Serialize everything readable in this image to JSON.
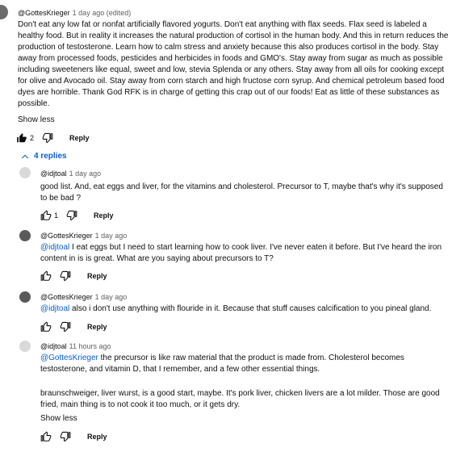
{
  "top_comment": {
    "author": "@GottesKrieger",
    "time": "1 day ago (edited)",
    "text": "Don't eat any low fat or nonfat artificially flavored yogurts. Don't eat anything with flax seeds. Flax seed is labeled a healthy food. But in reality it increases the natural production of cortisol in the human body. And this in return reduces the production of testosterone. Learn how to calm stress and anxiety because this also produces cortisol in the body. Stay away from processed foods, pesticides and herbicides in foods and GMO's. Stay away from sugar as much as possible including sweeteners like equal, sweet and low, stevia Splenda or any others. Stay away from all oils for cooking except for olive and Avocado oil. Stay away from corn starch and high fructose corn syrup. And chemical petroleum based food dyes are horrible. Thank God RFK is in charge of getting this crap out of our foods! Eat as little of these substances as possible.",
    "show_less": "Show less",
    "like_count": "2",
    "reply_label": "Reply",
    "like_icon": "thumbs-up-filled-icon",
    "dislike_icon": "thumbs-down-icon"
  },
  "replies_toggle": {
    "label": "4 replies",
    "icon": "chevron-up-icon"
  },
  "replies": [
    {
      "author": "@idjtoal",
      "time": "1 day ago",
      "text": "good list.  And, eat eggs and liver, for the vitamins and cholesterol.  Precursor to T, maybe that's why it's supposed to be bad ?",
      "like_count": "1",
      "reply_label": "Reply"
    },
    {
      "author": "@GottesKrieger",
      "time": "1 day ago",
      "mention": "@idjtoal",
      "text": " I eat eggs but I need to start learning how to cook liver. I've never eaten it before. But I've heard the iron content in is is great. What are you saying about precursors to T?",
      "reply_label": "Reply"
    },
    {
      "author": "@GottesKrieger",
      "time": "1 day ago",
      "mention": "@idjtoal",
      "text": " also i don't use anything with flouride in it. Because that stuff causes calcification to you pineal gland.",
      "reply_label": "Reply"
    },
    {
      "author": "@idjtoal",
      "time": "11 hours ago",
      "mention": "@GottesKrieger",
      "text_p1": "   the precursor is like raw material that the product is made from.  Cholesterol becomes testosterone, and vitamin D, that I remember, and a few other essential things.",
      "text_p2": "braunschweiger, liver wurst, is a good start, maybe.  It's pork liver, chicken livers are a lot milder.  Those are good fried, main thing is to not cook it too much, or it gets dry.",
      "show_less": "Show less",
      "reply_label": "Reply"
    }
  ]
}
